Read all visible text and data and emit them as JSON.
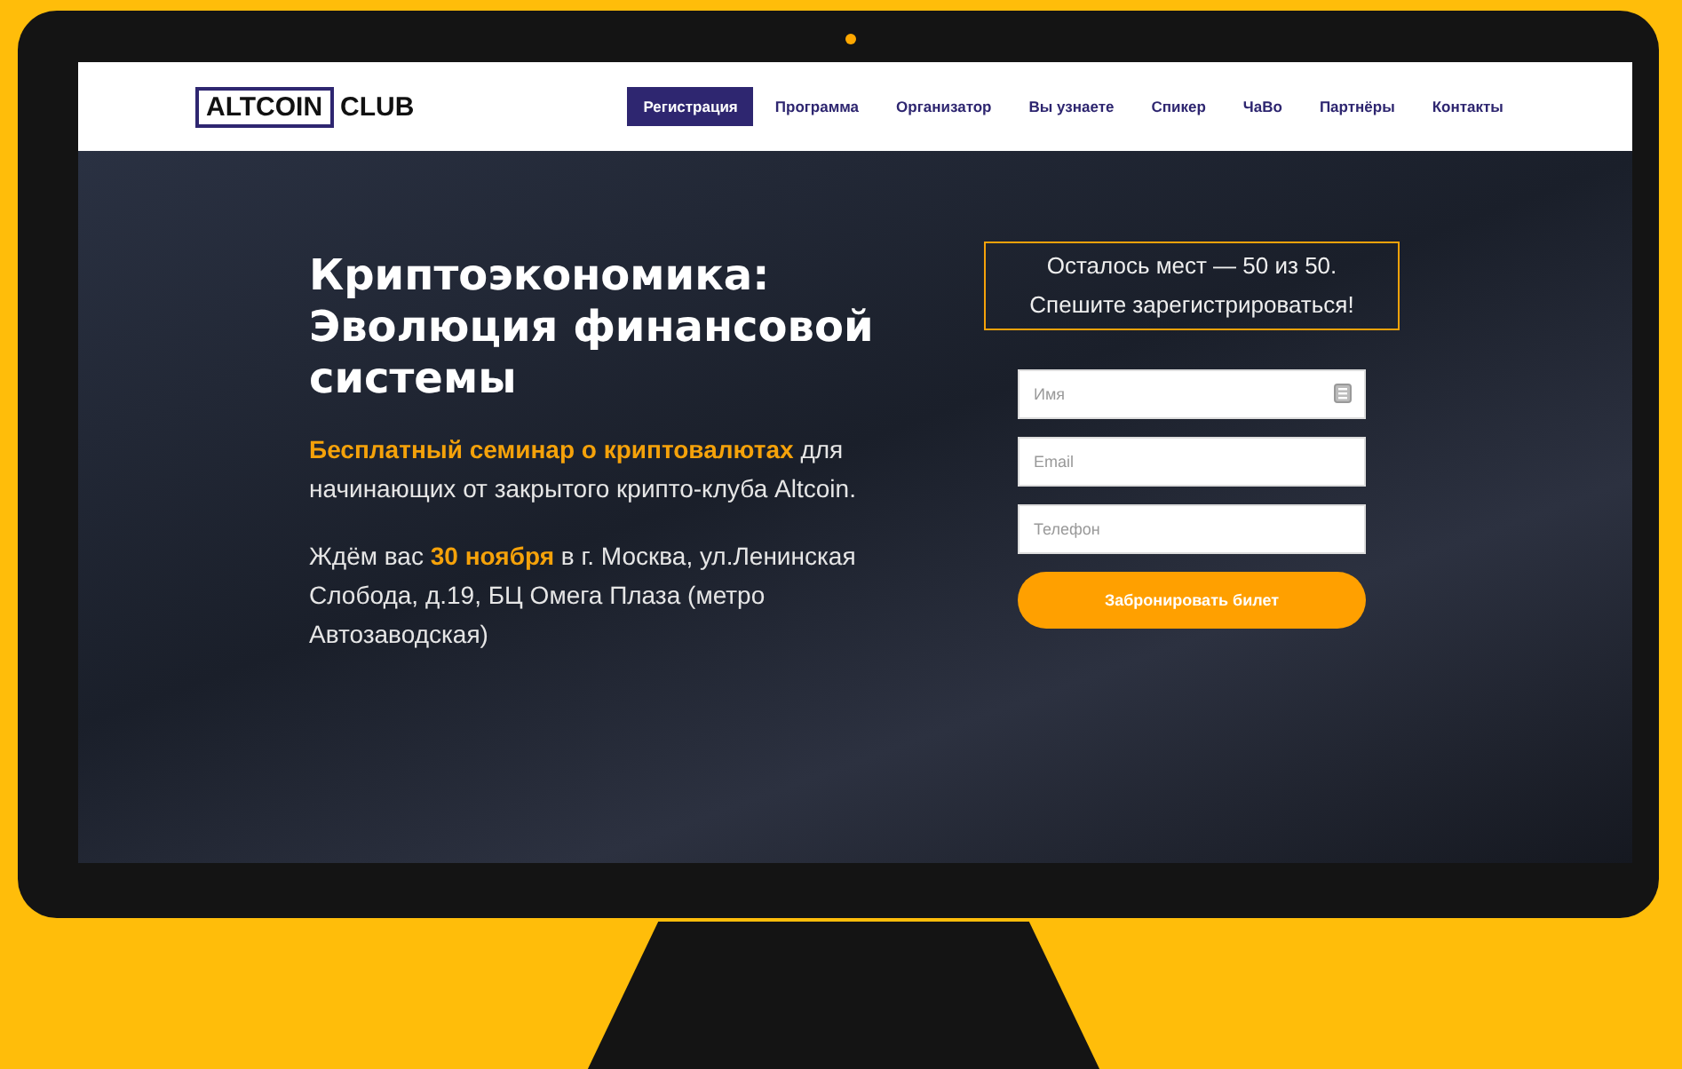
{
  "header": {
    "logo": {
      "boxed": "ALTCOIN",
      "plain": "CLUB"
    },
    "nav": [
      {
        "label": "Регистрация",
        "selected": true
      },
      {
        "label": "Программа",
        "selected": false
      },
      {
        "label": "Организатор",
        "selected": false
      },
      {
        "label": "Вы узнаете",
        "selected": false
      },
      {
        "label": "Спикер",
        "selected": false
      },
      {
        "label": "ЧаВо",
        "selected": false
      },
      {
        "label": "Партнёры",
        "selected": false
      },
      {
        "label": "Контакты",
        "selected": false
      }
    ]
  },
  "hero": {
    "title": "Криптоэкономика:\nЭволюция финансовой\nсистемы",
    "lead": "**Бесплатный семинар о криптовалютах** для начинающих от закрытого крипто-клуба Altcoin.",
    "details": "Ждём вас **30 ноября** в г. Москва, ул.Ленинская Слобода, д.19, БЦ Омега Плаза (метро Автозаводская)"
  },
  "form": {
    "notice": "Осталось мест — 50 из 50.\nСпешите зарегистрироваться!",
    "fields": [
      {
        "placeholder": "Имя",
        "kind": "name"
      },
      {
        "placeholder": "Email",
        "kind": "email"
      },
      {
        "placeholder": "Телефон",
        "kind": "phone"
      }
    ],
    "button": "Забронировать билет"
  }
}
